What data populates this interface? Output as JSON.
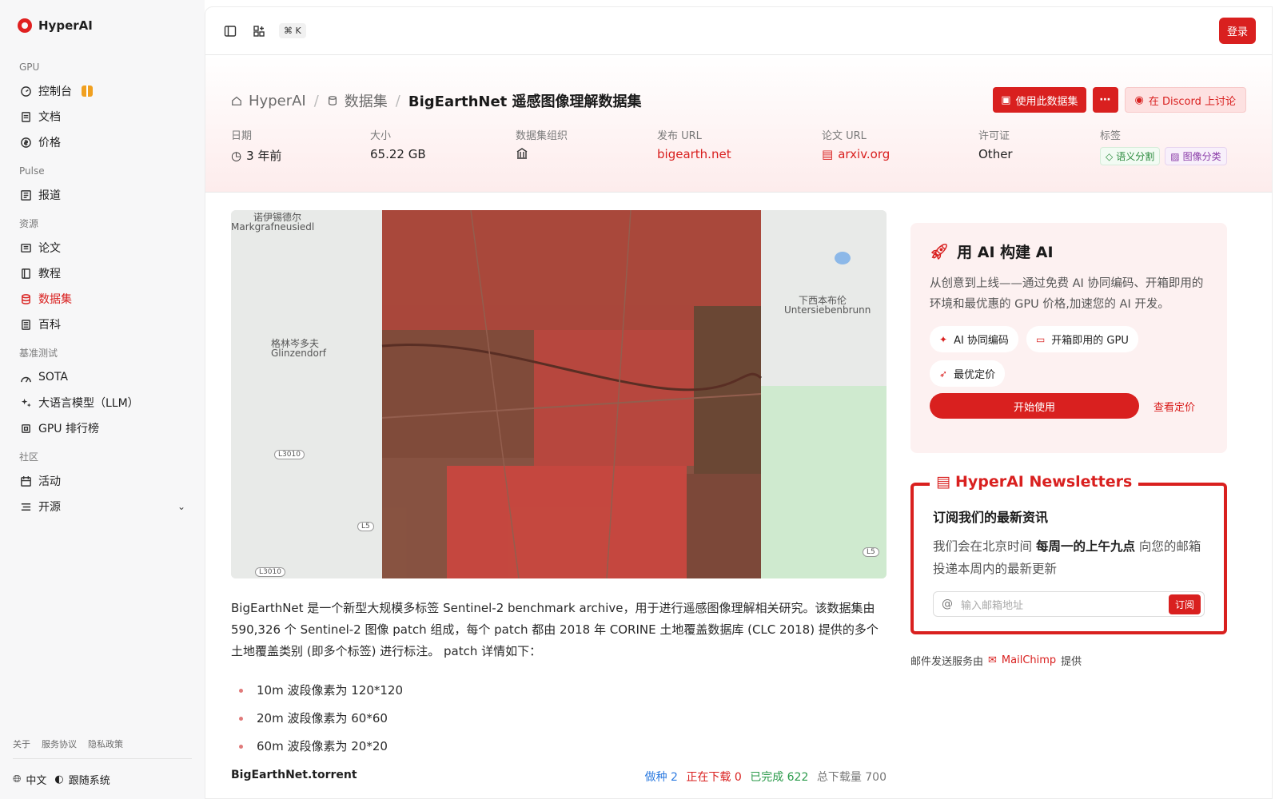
{
  "app": {
    "name": "HyperAI"
  },
  "sidebar": {
    "groups": [
      {
        "heading": "GPU",
        "items": [
          {
            "label": "控制台",
            "icon": "dashboard-icon"
          },
          {
            "label": "文档",
            "icon": "doc-icon"
          },
          {
            "label": "价格",
            "icon": "price-icon"
          }
        ]
      },
      {
        "heading": "Pulse",
        "items": [
          {
            "label": "报道",
            "icon": "news-icon"
          }
        ]
      },
      {
        "heading": "资源",
        "items": [
          {
            "label": "论文",
            "icon": "paper-icon"
          },
          {
            "label": "教程",
            "icon": "tutorial-icon"
          },
          {
            "label": "数据集",
            "icon": "dataset-icon",
            "active": true
          },
          {
            "label": "百科",
            "icon": "wiki-icon"
          }
        ]
      },
      {
        "heading": "基准测试",
        "items": [
          {
            "label": "SOTA",
            "icon": "chart-icon"
          },
          {
            "label": "大语言模型（LLM）",
            "icon": "sparkle-icon"
          },
          {
            "label": "GPU 排行榜",
            "icon": "cpu-icon"
          }
        ]
      },
      {
        "heading": "社区",
        "items": [
          {
            "label": "活动",
            "icon": "calendar-icon"
          },
          {
            "label": "开源",
            "icon": "list-icon"
          }
        ]
      }
    ],
    "footer": {
      "about": "关于",
      "terms": "服务协议",
      "privacy": "隐私政策",
      "language": "中文",
      "theme": "跟随系统"
    }
  },
  "topbar": {
    "shortcut": "⌘ K",
    "login": "登录"
  },
  "breadcrumb": {
    "home": "HyperAI",
    "section": "数据集",
    "current": "BigEarthNet 遥感图像理解数据集"
  },
  "actions": {
    "use": "使用此数据集",
    "discord": "在 Discord 上讨论"
  },
  "meta": {
    "date": {
      "label": "日期",
      "value": "3 年前"
    },
    "size": {
      "label": "大小",
      "value": "65.22 GB"
    },
    "org": {
      "label": "数据集组织"
    },
    "release_url": {
      "label": "发布 URL",
      "value": "bigearth.net"
    },
    "paper_url": {
      "label": "论文 URL",
      "value": "arxiv.org"
    },
    "license": {
      "label": "许可证",
      "value": "Other"
    },
    "tags": {
      "label": "标签",
      "items": [
        "语义分割",
        "图像分类"
      ]
    }
  },
  "map": {
    "labels": [
      "诺伊锡德尔",
      "Markgrafneusiedl",
      "格林岑多夫",
      "Glinzendorf",
      "下西本布伦",
      "Untersiebenbrunn"
    ],
    "roads": [
      "L3010",
      "L5",
      "L5",
      "L3010"
    ]
  },
  "description": "BigEarthNet 是一个新型大规模多标签 Sentinel-2 benchmark archive，用于进行遥感图像理解相关研究。该数据集由 590,326 个 Sentinel-2 图像 patch 组成，每个 patch 都由 2018 年 CORINE 土地覆盖数据库 (CLC 2018) 提供的多个土地覆盖类别 (即多个标签) 进行标注。 patch 详情如下：",
  "bullets": [
    "10m 波段像素为 120*120",
    "20m 波段像素为 60*60",
    "60m 波段像素为 20*20"
  ],
  "torrent": {
    "title": "BigEarthNet.torrent",
    "seeding": "做种 2",
    "downloading": "正在下载 0",
    "completed": "已完成 622",
    "total": "总下载量 700"
  },
  "promo": {
    "title": "用 AI 构建 AI",
    "text": "从创意到上线——通过免费 AI 协同编码、开箱即用的环境和最优惠的 GPU 价格,加速您的 AI 开发。",
    "pills": [
      "AI 协同编码",
      "开箱即用的 GPU",
      "最优定价"
    ],
    "start": "开始使用",
    "pricing": "查看定价"
  },
  "newsletter": {
    "title": "HyperAI Newsletters",
    "heading": "订阅我们的最新资讯",
    "text_pre": "我们会在北京时间 ",
    "text_bold": "每周一的上午九点",
    "text_post": " 向您的邮箱投递本周内的最新更新",
    "placeholder": "输入邮箱地址",
    "subscribe": "订阅",
    "provider_pre": "邮件发送服务由",
    "provider": "MailChimp",
    "provider_post": "提供"
  },
  "colors": {
    "accent": "#d9201f"
  }
}
